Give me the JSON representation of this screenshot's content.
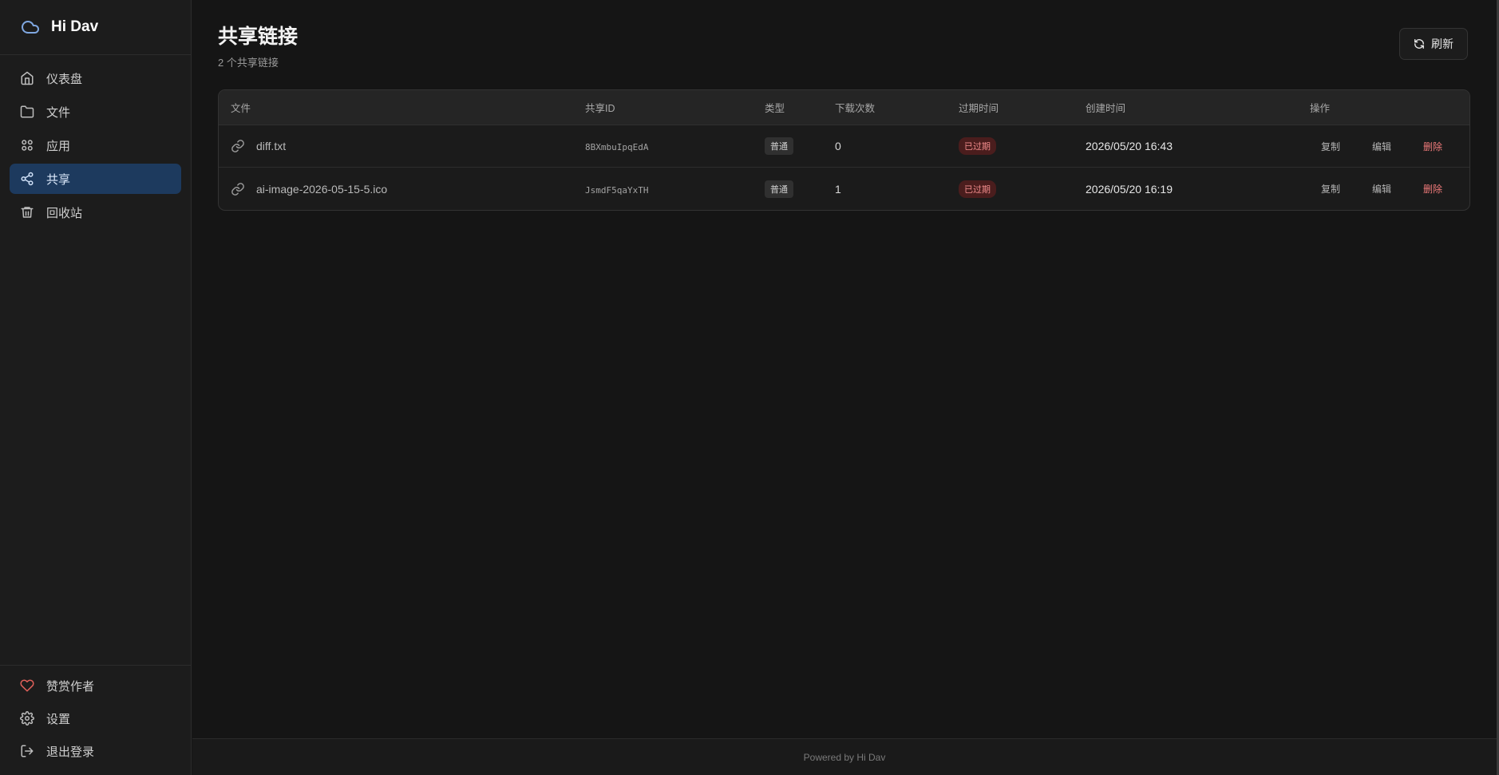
{
  "app": {
    "name": "Hi Dav"
  },
  "colors": {
    "accent": "#1d3a5e",
    "brand_icon": "#7fa7e0",
    "danger": "#ef7a7a",
    "heart": "#e0605a"
  },
  "sidebar": {
    "items": [
      {
        "label": "仪表盘",
        "icon": "home-icon",
        "active": false
      },
      {
        "label": "文件",
        "icon": "folder-icon",
        "active": false
      },
      {
        "label": "应用",
        "icon": "grid-icon",
        "active": false
      },
      {
        "label": "共享",
        "icon": "share-icon",
        "active": true
      },
      {
        "label": "回收站",
        "icon": "trash-icon",
        "active": false
      }
    ],
    "bottom_items": [
      {
        "label": "赞赏作者",
        "icon": "heart-icon"
      },
      {
        "label": "设置",
        "icon": "gear-icon"
      },
      {
        "label": "退出登录",
        "icon": "logout-icon"
      }
    ]
  },
  "header": {
    "title": "共享链接",
    "subtitle": "2 个共享链接",
    "refresh_label": "刷新"
  },
  "table": {
    "columns": [
      "文件",
      "共享ID",
      "类型",
      "下载次数",
      "过期时间",
      "创建时间",
      "操作"
    ],
    "rows": [
      {
        "file": "diff.txt",
        "share_id": "8BXmbuIpqEdA",
        "type": "普通",
        "downloads": "0",
        "expiry": "已过期",
        "created": "2026/05/20 16:43"
      },
      {
        "file": "ai-image-2026-05-15-5.ico",
        "share_id": "JsmdF5qaYxTH",
        "type": "普通",
        "downloads": "1",
        "expiry": "已过期",
        "created": "2026/05/20 16:19"
      }
    ],
    "actions": {
      "copy": "复制",
      "edit": "编辑",
      "delete": "删除"
    }
  },
  "footer": {
    "text": "Powered by Hi Dav"
  }
}
